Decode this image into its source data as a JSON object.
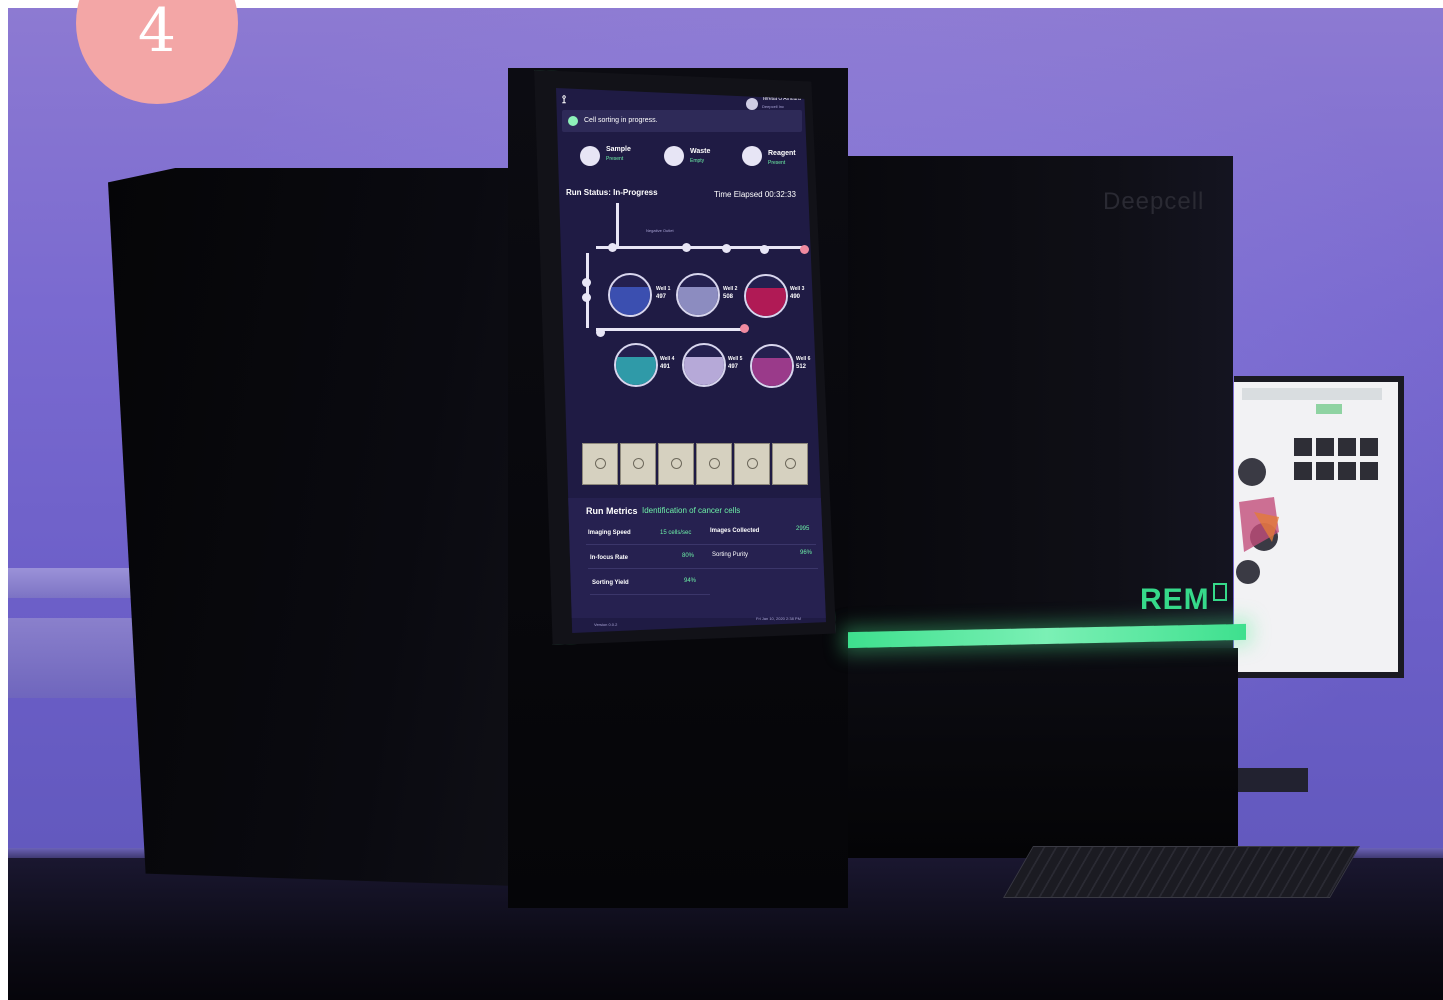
{
  "badge": {
    "number": "4"
  },
  "instrument": {
    "brand": "Deepcell",
    "model": "REM",
    "model_suffix": "I"
  },
  "screen": {
    "user_name": "Teresa O'Ameara",
    "user_sub": "Deepcell Inc",
    "status_message": "Cell sorting in progress.",
    "tiles": [
      {
        "label": "Sample",
        "state": "Present"
      },
      {
        "label": "Waste",
        "state": "Empty"
      },
      {
        "label": "Reagent",
        "state": "Present"
      }
    ],
    "run_status": "Run Status: In-Progress",
    "time_elapsed": "Time Elapsed 00:32:33",
    "negative_outlet": "Negative Outlet",
    "wells": [
      {
        "name": "Well 1",
        "count": "497",
        "color": "#3b4fb0"
      },
      {
        "name": "Well 2",
        "count": "508",
        "color": "#8c8cc0"
      },
      {
        "name": "Well 3",
        "count": "490",
        "color": "#b01a55"
      },
      {
        "name": "Well 4",
        "count": "491",
        "color": "#2f9aa8"
      },
      {
        "name": "Well 5",
        "count": "497",
        "color": "#b6a9d8"
      },
      {
        "name": "Well 6",
        "count": "512",
        "color": "#9a3a8a"
      }
    ],
    "metrics_title": "Run Metrics",
    "metrics_subtitle": "Identification of cancer cells",
    "metrics": {
      "imaging_speed_label": "Imaging Speed",
      "imaging_speed_value": "15 cells/sec",
      "images_collected_label": "Images Collected",
      "images_collected_value": "2995",
      "infocus_rate_label": "In-focus Rate",
      "infocus_rate_value": "80%",
      "sorting_purity_label": "Sorting Purity",
      "sorting_purity_value": "96%",
      "sorting_yield_label": "Sorting Yield",
      "sorting_yield_value": "94%"
    },
    "footer_left": "Version 0.0.2",
    "footer_right": "Fri Jan 10, 2020 2:38 PM"
  }
}
